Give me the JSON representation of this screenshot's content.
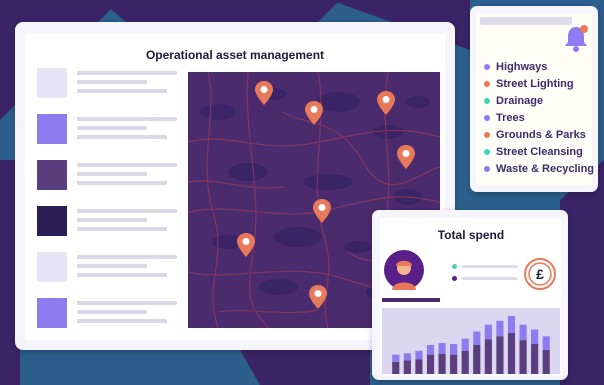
{
  "colors": {
    "background_blue": "#2c5f8c",
    "deep_purple": "#3a2466",
    "map_purple": "#4a2c6e",
    "accent_orange": "#e8795a",
    "accent_lilac": "#8e7bf0"
  },
  "main_panel": {
    "title": "Operational asset management",
    "list_items": [
      {
        "thumb_color": "#e6e4f6"
      },
      {
        "thumb_color": "#8e7bf0"
      },
      {
        "thumb_color": "#5b3e7e"
      },
      {
        "thumb_color": "#2b1e55"
      },
      {
        "thumb_color": "#e6e4f6"
      },
      {
        "thumb_color": "#8e7bf0"
      }
    ],
    "map": {
      "pin_icon": "map-pin-icon",
      "pin_count": 7
    }
  },
  "categories_panel": {
    "icon": "bell-icon",
    "items": [
      {
        "label": "Highways",
        "dot": "#8e7bf0"
      },
      {
        "label": "Street Lighting",
        "dot": "#e8795a"
      },
      {
        "label": "Drainage",
        "dot": "#3ed9b0"
      },
      {
        "label": "Trees",
        "dot": "#8e7bf0"
      },
      {
        "label": "Grounds & Parks",
        "dot": "#e8795a"
      },
      {
        "label": "Street Cleansing",
        "dot": "#3ed9b0"
      },
      {
        "label": "Waste & Recycling",
        "dot": "#8e7bf0"
      }
    ]
  },
  "spend_panel": {
    "title": "Total spend",
    "avatar_icon": "worker-avatar-icon",
    "currency_icon": "pound-coin-icon",
    "currency_symbol": "£",
    "legend_dots": [
      "#3ed9b0",
      "#5b1f8a"
    ]
  },
  "chart_data": {
    "type": "bar",
    "stacked": true,
    "bar_count": 14,
    "series": [
      {
        "values": [
          0.25,
          0.28,
          0.3,
          0.4,
          0.42,
          0.4,
          0.48,
          0.6,
          0.72,
          0.78,
          0.85,
          0.7,
          0.62,
          0.5
        ]
      },
      {
        "values": [
          0.15,
          0.15,
          0.18,
          0.2,
          0.22,
          0.22,
          0.25,
          0.28,
          0.3,
          0.32,
          0.35,
          0.32,
          0.3,
          0.28
        ]
      }
    ],
    "ylim": [
      0,
      1
    ],
    "grid": false,
    "colors": [
      "#5b3e7e",
      "#8e7bf0"
    ]
  }
}
